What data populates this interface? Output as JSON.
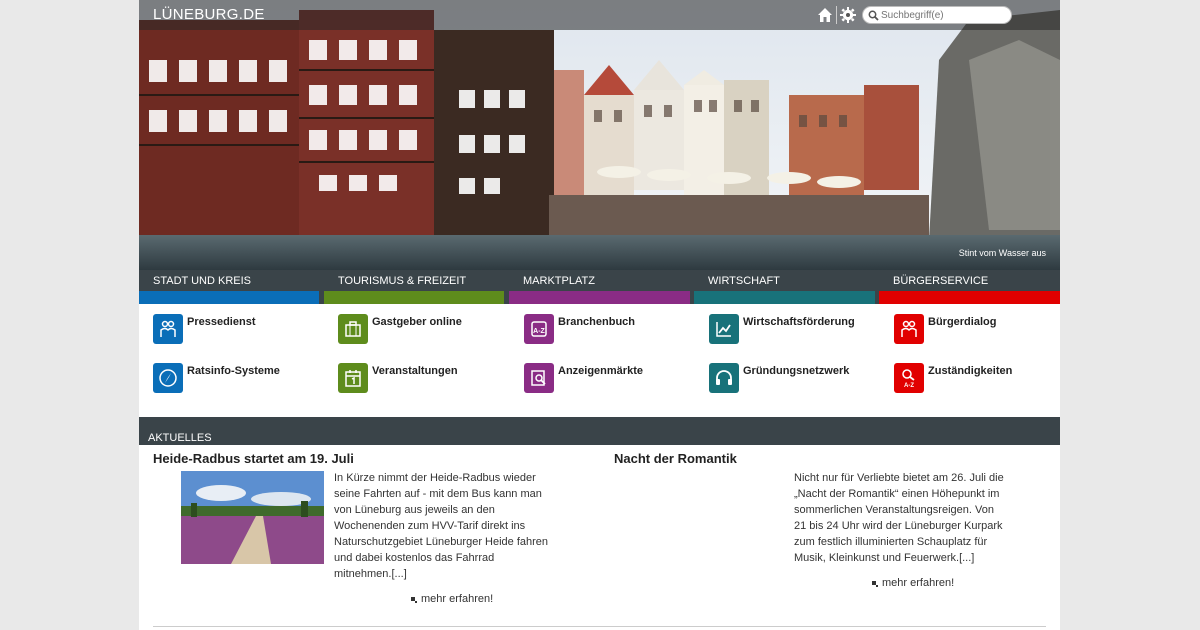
{
  "header": {
    "logo": "LÜNEBURG.DE",
    "search_placeholder": "Suchbegriff(e)",
    "icons": [
      "home-icon",
      "gear-icon",
      "search-icon"
    ]
  },
  "hero": {
    "caption": "Stint vom Wasser aus"
  },
  "nav": [
    {
      "label": "STADT UND KREIS",
      "color": "#0a6eb8"
    },
    {
      "label": "TOURISMUS & FREIZEIT",
      "color": "#5e8c1c"
    },
    {
      "label": "MARKTPLATZ",
      "color": "#8a2c85"
    },
    {
      "label": "WIRTSCHAFT",
      "color": "#18727a"
    },
    {
      "label": "BÜRGERSERVICE",
      "color": "#e10000"
    }
  ],
  "links": [
    [
      {
        "label": "Pressedienst",
        "icon": "people-icon"
      },
      {
        "label": "Ratsinfo-Systeme",
        "icon": "compass-icon"
      }
    ],
    [
      {
        "label": "Gastgeber online",
        "icon": "suitcase-icon"
      },
      {
        "label": "Veranstaltungen",
        "icon": "calendar-icon"
      }
    ],
    [
      {
        "label": "Branchenbuch",
        "icon": "book-icon"
      },
      {
        "label": "Anzeigenmärkte",
        "icon": "search-doc-icon"
      }
    ],
    [
      {
        "label": "Wirtschaftsförderung",
        "icon": "chart-icon"
      },
      {
        "label": "Gründungsnetzwerk",
        "icon": "headset-icon"
      }
    ],
    [
      {
        "label": "Bürgerdialog",
        "icon": "people-icon"
      },
      {
        "label": "Zuständigkeiten",
        "icon": "search-az-icon"
      }
    ]
  ],
  "news": {
    "heading": "AKTUELLES",
    "articles": [
      {
        "title": "Heide-Radbus startet am 19. Juli",
        "lines": [
          "In Kürze nimmt der Heide-Radbus wieder",
          "seine Fahrten auf - mit dem Bus kann man",
          "von Lüneburg aus jeweils an den",
          "Wochenenden zum HVV-Tarif direkt ins",
          "Naturschutzgebiet Lüneburger Heide fahren",
          "und dabei kostenlos das Fahrrad",
          "mitnehmen.[...]"
        ],
        "more": "mehr erfahren!"
      },
      {
        "title": "Nacht der Romantik",
        "lines": [
          "Nicht nur für Verliebte bietet am 26. Juli die",
          "„Nacht der Romantik“ einen Höhepunkt im",
          "sommerlichen Veranstaltungsreigen. Von",
          "21 bis 24 Uhr wird der Lüneburger Kurpark",
          "zum festlich illuminierten Schauplatz für",
          "Musik, Kleinkunst und Feuerwerk.[...]"
        ],
        "more": "mehr erfahren!"
      }
    ]
  }
}
